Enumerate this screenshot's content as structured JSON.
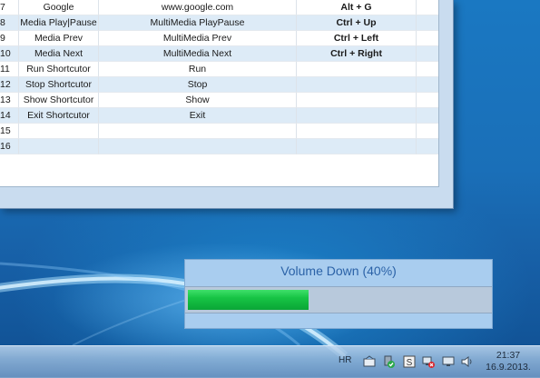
{
  "table": {
    "rows": [
      {
        "num": "7",
        "name": "Google",
        "action": "www.google.com",
        "hotkey": "Alt + G"
      },
      {
        "num": "8",
        "name": "Media Play|Pause",
        "action": "MultiMedia PlayPause",
        "hotkey": "Ctrl + Up"
      },
      {
        "num": "9",
        "name": "Media Prev",
        "action": "MultiMedia Prev",
        "hotkey": "Ctrl + Left"
      },
      {
        "num": "10",
        "name": "Media Next",
        "action": "MultiMedia Next",
        "hotkey": "Ctrl + Right"
      },
      {
        "num": "11",
        "name": "Run Shortcutor",
        "action": "Run",
        "hotkey": ""
      },
      {
        "num": "12",
        "name": "Stop Shortcutor",
        "action": "Stop",
        "hotkey": ""
      },
      {
        "num": "13",
        "name": "Show Shortcutor",
        "action": "Show",
        "hotkey": ""
      },
      {
        "num": "14",
        "name": "Exit Shortcutor",
        "action": "Exit",
        "hotkey": ""
      },
      {
        "num": "15",
        "name": "",
        "action": "",
        "hotkey": ""
      },
      {
        "num": "16",
        "name": "",
        "action": "",
        "hotkey": ""
      }
    ]
  },
  "osd": {
    "title": "Volume Down (40%)",
    "level_percent": 40,
    "fill_color": "#17c445"
  },
  "taskbar": {
    "language": "HR",
    "tray_icons": [
      "bluetooth-icon",
      "safely-remove-icon",
      "s-app-icon",
      "network-error-icon",
      "display-icon",
      "speaker-icon"
    ],
    "time": "21:37",
    "date": "16.9.2013."
  }
}
